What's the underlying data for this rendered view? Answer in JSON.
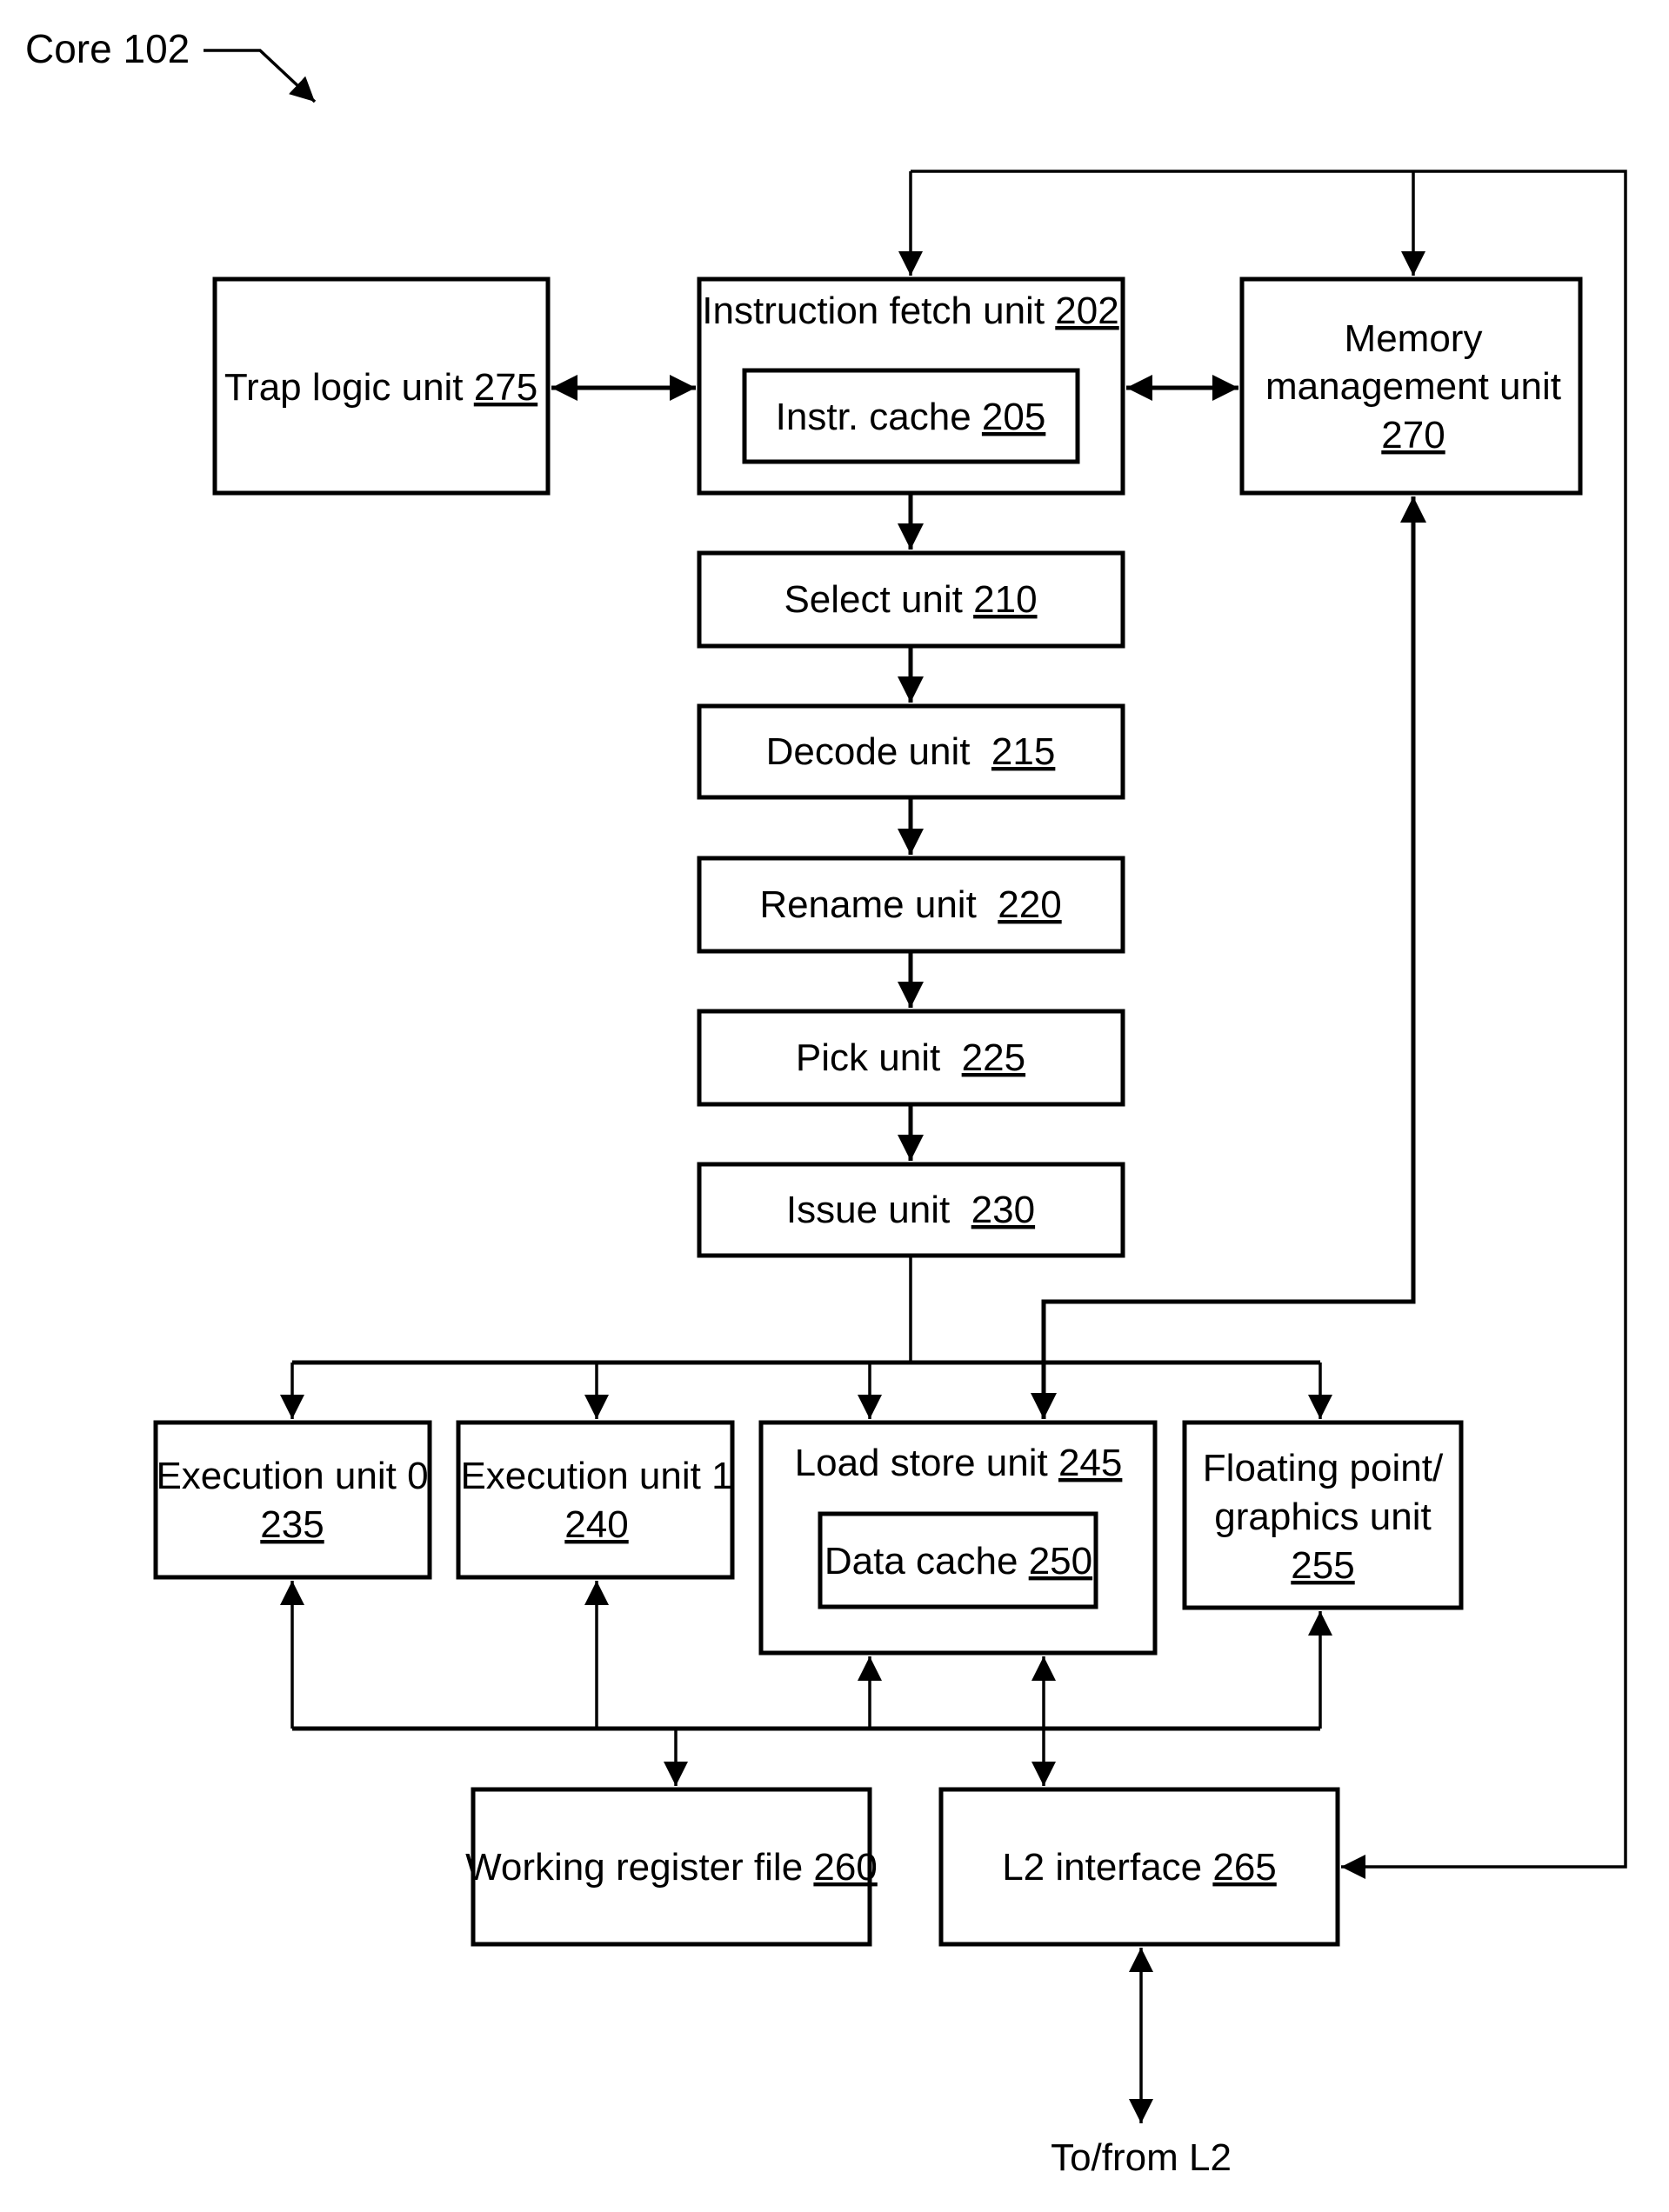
{
  "figure": {
    "label": "Core 102"
  },
  "units": {
    "trap_logic": {
      "name": "Trap logic unit ",
      "ref": "275"
    },
    "instruction_fetch": {
      "name": "Instruction fetch unit ",
      "ref": "202"
    },
    "instr_cache": {
      "name": "Instr. cache ",
      "ref": "205"
    },
    "mmu": {
      "line1": "Memory",
      "line2": "management unit",
      "ref": "270"
    },
    "select": {
      "name": "Select unit ",
      "ref": "210"
    },
    "decode": {
      "name": "Decode unit  ",
      "ref": "215"
    },
    "rename": {
      "name": "Rename unit  ",
      "ref": "220"
    },
    "pick": {
      "name": "Pick unit  ",
      "ref": "225"
    },
    "issue": {
      "name": "Issue unit  ",
      "ref": "230"
    },
    "exec0": {
      "name": "Execution unit 0",
      "ref": "235"
    },
    "exec1": {
      "name": "Execution unit 1",
      "ref": "240"
    },
    "load_store": {
      "name": "Load store unit ",
      "ref": "245"
    },
    "data_cache": {
      "name": "Data cache ",
      "ref": "250"
    },
    "fp_graphics": {
      "line1": "Floating point/",
      "line2": "graphics unit",
      "ref": "255"
    },
    "working_register_file": {
      "name": "Working register file ",
      "ref": "260"
    },
    "l2_interface": {
      "name": "L2 interface ",
      "ref": "265"
    }
  },
  "external": {
    "to_from_l2": "To/from L2"
  }
}
